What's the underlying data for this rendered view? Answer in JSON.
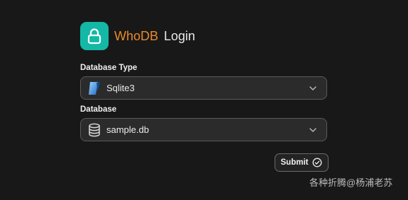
{
  "header": {
    "brand": "WhoDB",
    "title": "Login",
    "logo_icon": "lock-icon",
    "logo_color": "#14b8a6",
    "brand_color": "#e88a2c"
  },
  "form": {
    "database_type": {
      "label": "Database Type",
      "value": "Sqlite3",
      "icon": "sqlite-icon"
    },
    "database": {
      "label": "Database",
      "value": "sample.db",
      "icon": "database-icon"
    },
    "submit_label": "Submit"
  },
  "watermark": "各种折腾@杨浦老苏"
}
